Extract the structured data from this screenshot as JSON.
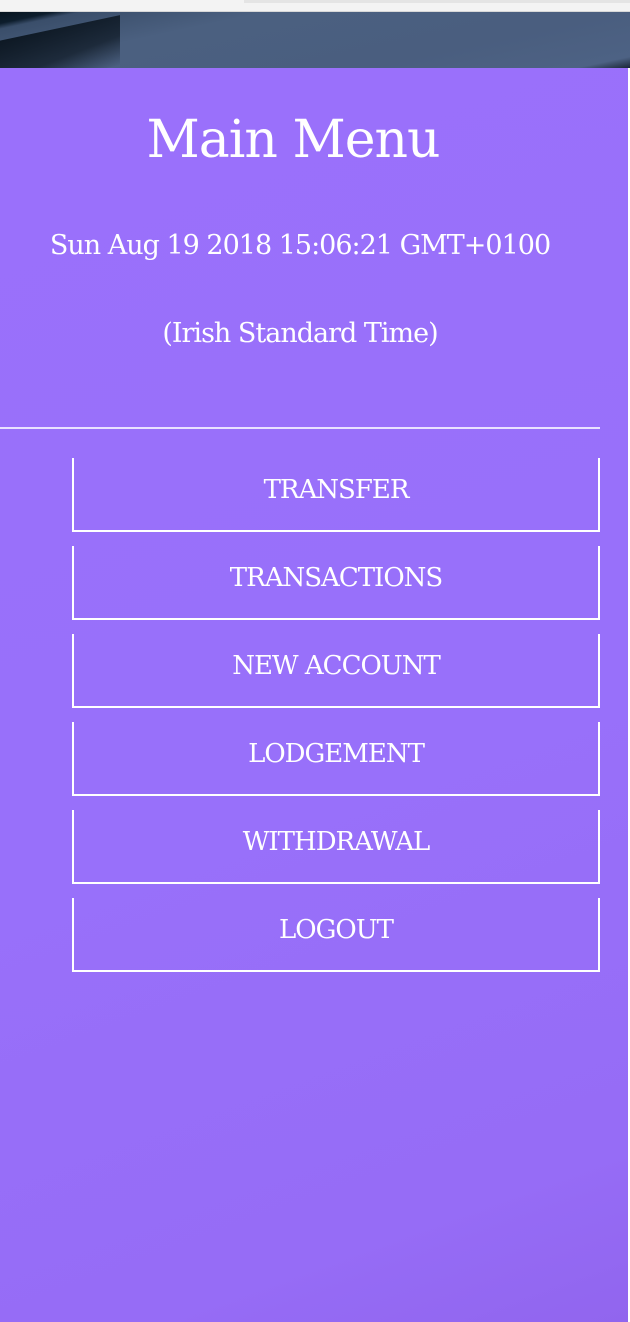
{
  "page": {
    "title": "Main Menu",
    "datetime": "Sun Aug 19 2018 15:06:21 GMT+0100 (Irish Standard Time)"
  },
  "menu": {
    "items": [
      {
        "label": "TRANSFER"
      },
      {
        "label": "TRANSACTIONS"
      },
      {
        "label": "NEW ACCOUNT"
      },
      {
        "label": "LODGEMENT"
      },
      {
        "label": "WITHDRAWAL"
      },
      {
        "label": "LOGOUT"
      }
    ]
  },
  "colors": {
    "panel_background": "#9a70fb",
    "text": "#ffffff",
    "banner": "#4b6080"
  }
}
